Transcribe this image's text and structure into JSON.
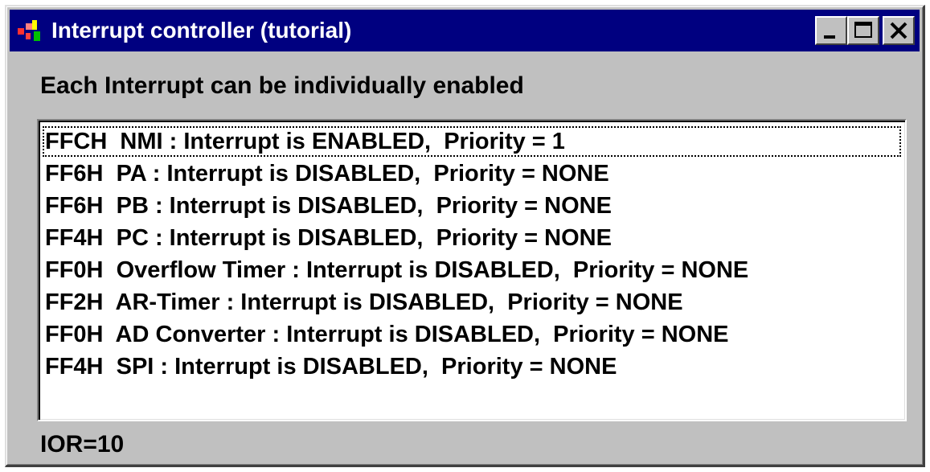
{
  "window": {
    "title": "Interrupt controller (tutorial)",
    "icon": "app-icon",
    "controls": [
      "minimize",
      "maximize",
      "close"
    ]
  },
  "subtitle": "Each Interrupt can be individually enabled",
  "interrupts": [
    {
      "text": "FFCH  NMI : Interrupt is ENABLED,  Priority = 1"
    },
    {
      "text": "FF6H  PA : Interrupt is DISABLED,  Priority = NONE"
    },
    {
      "text": "FF6H  PB : Interrupt is DISABLED,  Priority = NONE"
    },
    {
      "text": "FF4H  PC : Interrupt is DISABLED,  Priority = NONE"
    },
    {
      "text": "FF0H  Overflow Timer : Interrupt is DISABLED,  Priority = NONE"
    },
    {
      "text": "FF2H  AR-Timer : Interrupt is DISABLED,  Priority = NONE"
    },
    {
      "text": "FF0H  AD Converter : Interrupt is DISABLED,  Priority = NONE"
    },
    {
      "text": "FF4H  SPI : Interrupt is DISABLED,  Priority = NONE"
    }
  ],
  "status": "IOR=10",
  "colors": {
    "titlebar": "#000080",
    "window": "#c0c0c0",
    "list_bg": "#ffffff"
  }
}
